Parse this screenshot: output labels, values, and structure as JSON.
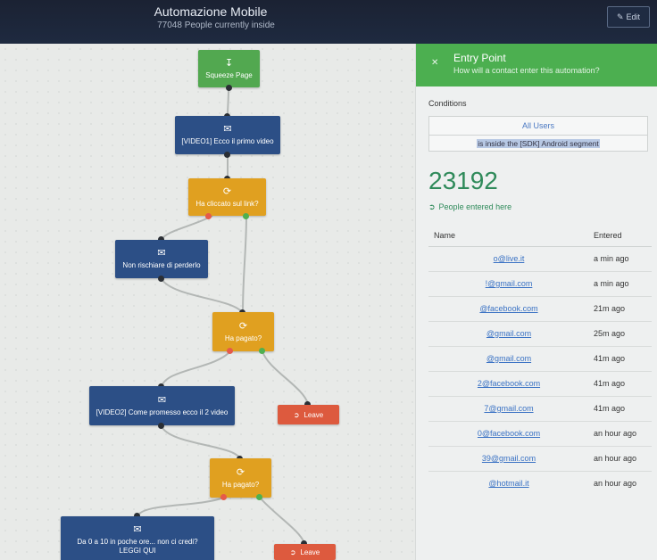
{
  "header": {
    "title": "Automazione Mobile",
    "subtitle": "77048 People currently inside",
    "edit_label": "Edit"
  },
  "canvas": {
    "nodes": {
      "squeeze": "Squeeze Page",
      "video1": "[VIDEO1] Ecco il primo video",
      "cond1": "Ha cliccato sul link?",
      "nonrischiare": "Non rischiare di perderlo",
      "pagato1": "Ha pagato?",
      "video2": "[VIDEO2] Come promesso ecco il 2 video",
      "leave1": "Leave",
      "pagato2": "Ha pagato?",
      "da0a10_line1": "Da 0 a 10 in poche ore... non ci credi?",
      "da0a10_line2": "LEGGI QUI",
      "leave2": "Leave"
    }
  },
  "panel": {
    "entry_title": "Entry Point",
    "entry_subtitle": "How will a contact enter this automation?",
    "conditions_label": "Conditions",
    "conditions": {
      "audience": "All Users",
      "rule": "is inside the [SDK] Android segment"
    },
    "count": "23192",
    "entered_label": "People entered here",
    "columns": {
      "name": "Name",
      "entered": "Entered"
    },
    "rows": [
      {
        "email": "o@live.it",
        "time": "a min ago"
      },
      {
        "email": "!@gmail.com",
        "time": "a min ago"
      },
      {
        "email": "@facebook.com",
        "time": "21m ago"
      },
      {
        "email": "@gmail.com",
        "time": "25m ago"
      },
      {
        "email": "@gmail.com",
        "time": "41m ago"
      },
      {
        "email": "2@facebook.com",
        "time": "41m ago"
      },
      {
        "email": "7@gmail.com",
        "time": "41m ago"
      },
      {
        "email": "0@facebook.com",
        "time": "an hour ago"
      },
      {
        "email": "39@gmail.com",
        "time": "an hour ago"
      },
      {
        "email": "@hotmail.it",
        "time": "an hour ago"
      }
    ]
  },
  "colors": {
    "header_bg": "#1e2a40",
    "entry_green": "#4caf50",
    "node_green": "#52a850",
    "node_blue": "#2c4f86",
    "node_orange": "#e0a020",
    "node_red": "#dd5a3e",
    "link_blue": "#3a72c4",
    "count_green": "#2f8a5a"
  },
  "icons": {
    "squeeze": "download-box-icon",
    "email": "envelope-icon",
    "condition": "fork-arrow-icon",
    "leave": "exit-icon",
    "close": "close-icon",
    "edit": "pencil-icon",
    "entered": "running-person-icon"
  }
}
